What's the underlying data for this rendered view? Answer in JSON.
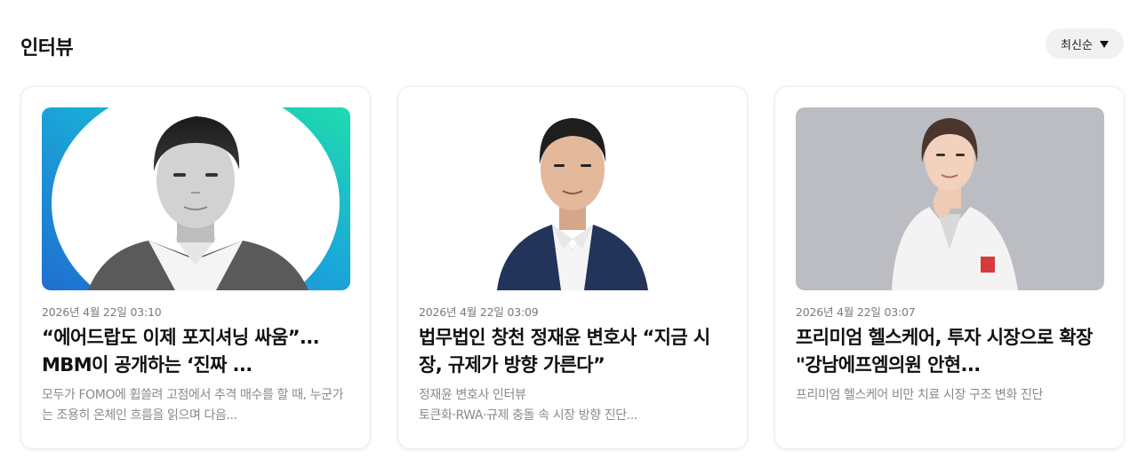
{
  "header": {
    "title": "인터뷰",
    "sort_label": "최신순"
  },
  "cards": [
    {
      "date": "2026년 4월 22일 03:10",
      "title": "“에어드랍도 이제 포지셔닝 싸움”... MBM이 공개하는 ‘진짜 ...",
      "desc": "모두가 FOMO에 휩쓸려 고점에서 추격 매수를 할 때, 누군가는 조용히 온체인 흐름을 읽으며 다음..."
    },
    {
      "date": "2026년 4월 22일 03:09",
      "title": "법무법인 창천 정재윤 변호사 “지금 시장, 규제가 방향 가른다”",
      "desc_line1": "정재윤 변호사 인터뷰",
      "desc_line2": "토큰화·RWA·규제 충돌 속 시장 방향 진단..."
    },
    {
      "date": "2026년 4월 22일 03:07",
      "title": "프리미엄 헬스케어, 투자 시장으로 확장 \"강남에프엠의원 안현...",
      "desc": "프리미엄 헬스케어 비만 치료 시장 구조 변화 진단"
    }
  ],
  "colors": {
    "card1_gradient_start": "#1f78d1",
    "card1_gradient_end": "#1fd6b0",
    "card3_bg": "#b9bbc1",
    "suit": "#22345a"
  }
}
